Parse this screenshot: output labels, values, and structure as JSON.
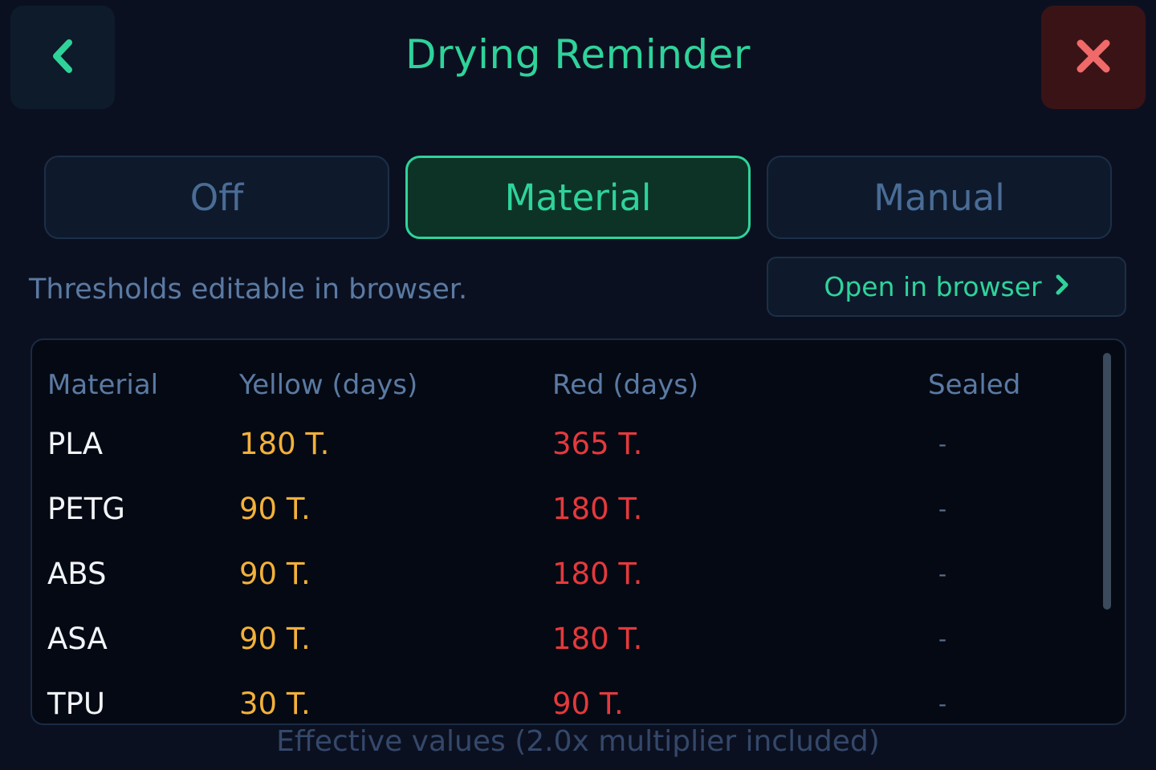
{
  "header": {
    "title": "Drying Reminder",
    "back_icon": "chevron-left-icon",
    "close_icon": "close-icon"
  },
  "mode_tabs": {
    "selected": "Material",
    "items": [
      {
        "label": "Off"
      },
      {
        "label": "Material"
      },
      {
        "label": "Manual"
      }
    ]
  },
  "hint": "Thresholds editable in browser.",
  "open_browser": {
    "label": "Open in browser",
    "icon": "chevron-right-icon"
  },
  "table": {
    "columns": [
      "Material",
      "Yellow (days)",
      "Red (days)",
      "Sealed"
    ],
    "rows": [
      {
        "material": "PLA",
        "yellow": "180 T.",
        "red": "365 T.",
        "sealed": "-"
      },
      {
        "material": "PETG",
        "yellow": "90 T.",
        "red": "180 T.",
        "sealed": "-"
      },
      {
        "material": "ABS",
        "yellow": "90 T.",
        "red": "180 T.",
        "sealed": "-"
      },
      {
        "material": "ASA",
        "yellow": "90 T.",
        "red": "180 T.",
        "sealed": "-"
      },
      {
        "material": "TPU",
        "yellow": "30 T.",
        "red": "90 T.",
        "sealed": "-"
      }
    ]
  },
  "footer": "Effective values (2.0x multiplier included)",
  "colors": {
    "accent": "#2fd39a",
    "yellow": "#f2b13a",
    "red": "#e5393d",
    "background": "#0b1020"
  }
}
